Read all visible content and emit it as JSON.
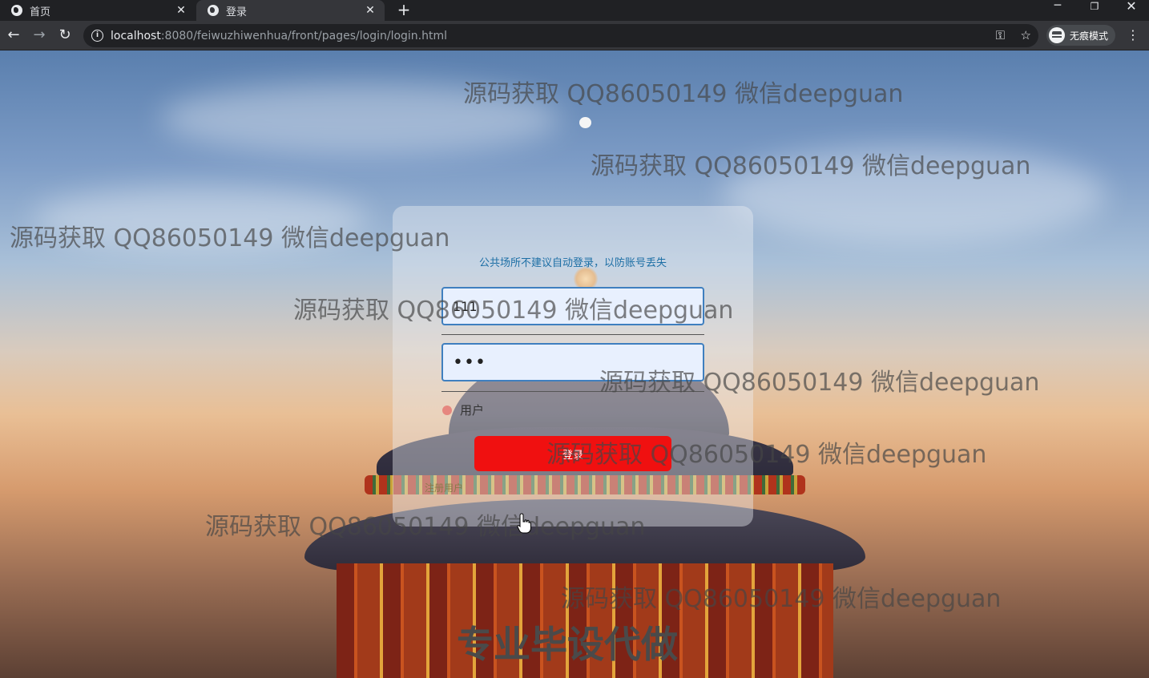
{
  "browser": {
    "tabs": [
      {
        "title": "首页",
        "close": "✕"
      },
      {
        "title": "登录",
        "close": "✕"
      }
    ],
    "new_tab": "+",
    "window_controls": {
      "minimize": "─",
      "maximize": "❐",
      "close": "✕"
    },
    "nav": {
      "back": "←",
      "forward": "→",
      "reload": "↻"
    },
    "url_host": "localhost",
    "url_path": ":8080/feiwuzhiwenhua/front/pages/login/login.html",
    "incognito_label": "无痕模式",
    "menu": "⋮"
  },
  "login": {
    "hint": "公共场所不建议自动登录，以防账号丢失",
    "username_value": "111",
    "password_display": "•••",
    "role_label": "用户",
    "login_button": "登录",
    "register_link": "注册用户"
  },
  "watermarks": [
    "源码获取 QQ86050149 微信deepguan",
    "源码获取 QQ86050149 微信deepguan",
    "源码获取 QQ86050149 微信deepguan",
    "源码获取 QQ86050149 微信deepguan",
    "源码获取 QQ86050149 微信deepguan",
    "源码获取 QQ86050149 微信deepguan",
    "源码获取 QQ86050149 微信deepguan",
    "源码获取 QQ86050149 微信deepguan",
    "源码获取 QQ86050149 微信deepguan"
  ],
  "watermark_bottom": "专业毕设代做",
  "colors": {
    "login_button": "#f01010",
    "hint_text": "#1d6fa5",
    "input_border": "#3f7fbf"
  }
}
